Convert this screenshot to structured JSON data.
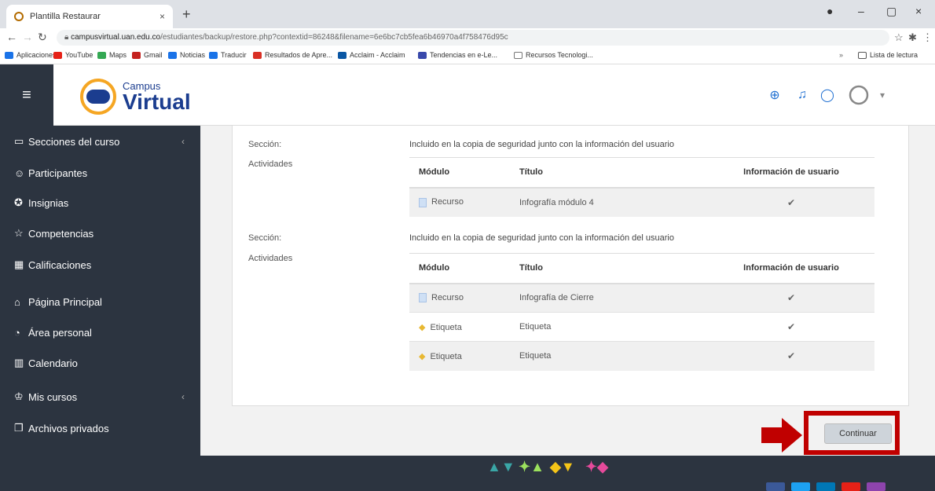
{
  "browser": {
    "tab_title": "Plantilla Restaurar",
    "tab_close": "×",
    "new_tab": "+",
    "url_domain": "campusvirtual.uan.edu.co",
    "url_path": "/estudiantes/backup/restore.php?contextid=86248&filename=6e6bc7cb5fea6b46970a4f758476d95c",
    "bookmarks": [
      {
        "label": "Aplicaciones",
        "icon": "apps-grid-icon",
        "color": "#1a73e8"
      },
      {
        "label": "YouTube",
        "icon": "youtube-icon",
        "color": "#e62117"
      },
      {
        "label": "Maps",
        "icon": "maps-pin-icon",
        "color": "#34a853"
      },
      {
        "label": "Gmail",
        "icon": "gmail-icon",
        "color": "#c5221f"
      },
      {
        "label": "Noticias",
        "icon": "news-icon",
        "color": "#1a73e8"
      },
      {
        "label": "Traducir",
        "icon": "translate-icon",
        "color": "#1a73e8"
      },
      {
        "label": "Resultados de Apre...",
        "icon": "results-icon",
        "color": "#d93025"
      },
      {
        "label": "Acclaim - Acclaim",
        "icon": "acclaim-icon",
        "color": "#0b57a4"
      },
      {
        "label": "Tendencias en e-Le...",
        "icon": "trends-icon",
        "color": "#3949ab"
      },
      {
        "label": "Recursos Tecnologi...",
        "icon": "file-icon",
        "color": "#777777"
      }
    ],
    "reading_list": "Lista de lectura"
  },
  "header": {
    "logo_small": "Campus",
    "logo_big": "Virtual",
    "accent": "#1b3d8f"
  },
  "sidebar": {
    "items": [
      {
        "label": "Secciones del curso",
        "icon": "folder-icon",
        "chevron": "‹"
      },
      {
        "label": "Participantes",
        "icon": "users-icon"
      },
      {
        "label": "Insignias",
        "icon": "badge-icon"
      },
      {
        "label": "Competencias",
        "icon": "star-icon"
      },
      {
        "label": "Calificaciones",
        "icon": "grades-table-icon"
      },
      {
        "label": "Página Principal",
        "icon": "home-icon"
      },
      {
        "label": "Área personal",
        "icon": "dashboard-icon"
      },
      {
        "label": "Calendario",
        "icon": "calendar-icon"
      },
      {
        "label": "Mis cursos",
        "icon": "graduation-cap-icon",
        "chevron": "‹"
      },
      {
        "label": "Archivos privados",
        "icon": "files-icon"
      }
    ]
  },
  "main": {
    "sections": [
      {
        "section_label": "Sección:",
        "activities_label": "Actividades",
        "note": "Incluido en la copia de seguridad junto con la información del usuario",
        "headers": [
          "Módulo",
          "Título",
          "Información de usuario"
        ],
        "rows": [
          {
            "modulo": "Recurso",
            "titulo": "Infografía módulo 4",
            "check": "✔",
            "icon": "document-icon"
          }
        ]
      },
      {
        "section_label": "Sección:",
        "activities_label": "Actividades",
        "note": "Incluido en la copia de seguridad junto con la información del usuario",
        "headers": [
          "Módulo",
          "Título",
          "Información de usuario"
        ],
        "rows": [
          {
            "modulo": "Recurso",
            "titulo": "Infografía de Cierre",
            "check": "✔",
            "icon": "document-icon"
          },
          {
            "modulo": "Etiqueta",
            "titulo": "Etiqueta",
            "check": "✔",
            "icon": "tag-icon"
          },
          {
            "modulo": "Etiqueta",
            "titulo": "Etiqueta",
            "check": "✔",
            "icon": "tag-icon"
          }
        ]
      }
    ],
    "continue_label": "Continuar",
    "highlight_color": "#c00000"
  }
}
